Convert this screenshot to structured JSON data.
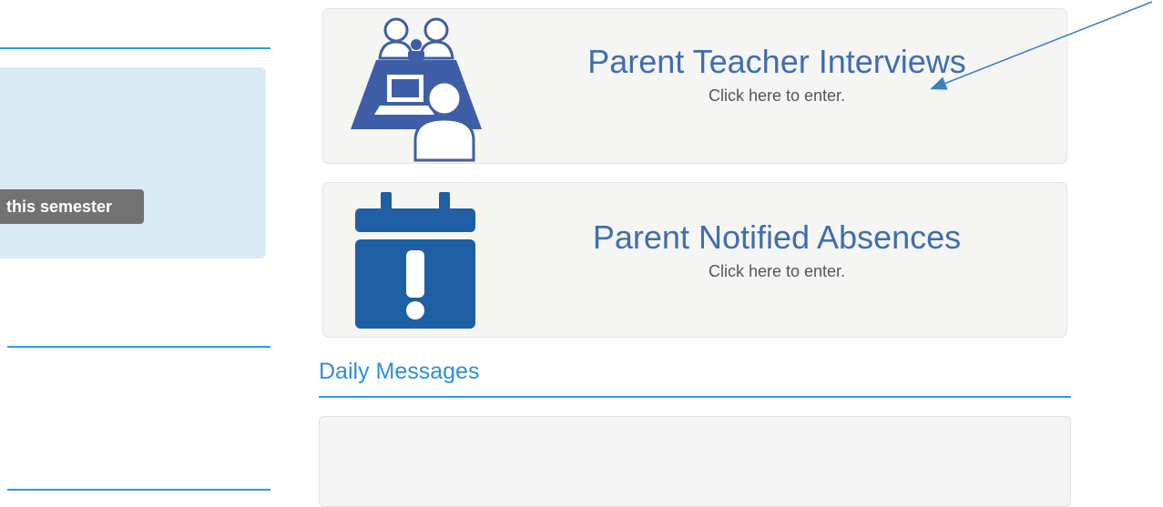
{
  "sidebar": {
    "semester_badge": "this semester"
  },
  "tiles": [
    {
      "title": "Parent Teacher Interviews",
      "subtitle": "Click here to enter.",
      "icon": "teacher-interview-icon"
    },
    {
      "title": "Parent Notified Absences",
      "subtitle": "Click here to enter.",
      "icon": "calendar-alert-icon"
    }
  ],
  "daily_messages": {
    "title": "Daily Messages"
  },
  "colors": {
    "accent": "#2d9be0",
    "tile_title": "#3e6eb0",
    "icon_blue": "#3e5ea8",
    "calendar_blue": "#1f5fa6",
    "panel_bg": "#d8ebf5"
  }
}
